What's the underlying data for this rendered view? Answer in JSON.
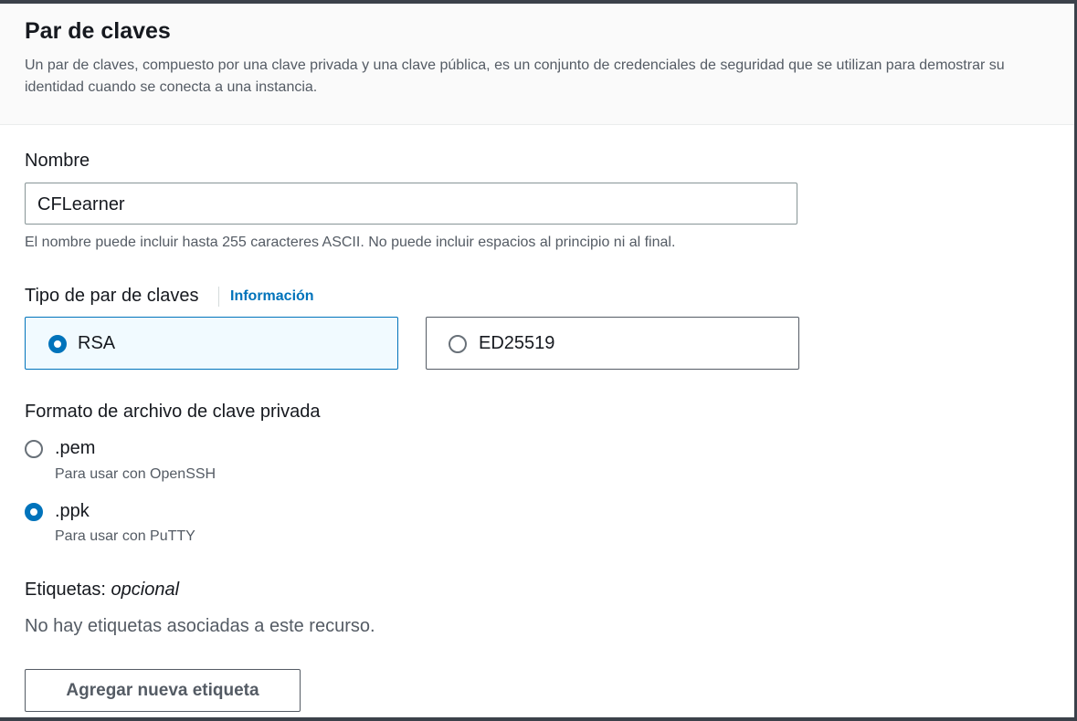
{
  "header": {
    "title": "Par de claves",
    "description": "Un par de claves, compuesto por una clave privada y una clave pública, es un conjunto de credenciales de seguridad que se utilizan para demostrar su identidad cuando se conecta a una instancia."
  },
  "name_field": {
    "label": "Nombre",
    "value": "CFLearner",
    "hint": "El nombre puede incluir hasta 255 caracteres ASCII. No puede incluir espacios al principio ni al final."
  },
  "key_type": {
    "label": "Tipo de par de claves",
    "info_link": "Información",
    "options": [
      {
        "label": "RSA",
        "selected": true
      },
      {
        "label": "ED25519",
        "selected": false
      }
    ]
  },
  "file_format": {
    "label": "Formato de archivo de clave privada",
    "options": [
      {
        "label": ".pem",
        "description": "Para usar con OpenSSH",
        "selected": false
      },
      {
        "label": ".ppk",
        "description": "Para usar con PuTTY",
        "selected": true
      }
    ]
  },
  "tags": {
    "label": "Etiquetas:",
    "optional": "opcional",
    "empty_text": "No hay etiquetas asociadas a este recurso.",
    "add_button": "Agregar nueva etiqueta"
  },
  "colors": {
    "accent": "#0073bb",
    "selected_tile_bg": "#f1faff",
    "header_bg": "#fafafa",
    "frame_border": "#3b414a"
  },
  "icons": {
    "radio_checked": "radio-checked-icon",
    "radio_unchecked": "radio-unchecked-icon"
  }
}
